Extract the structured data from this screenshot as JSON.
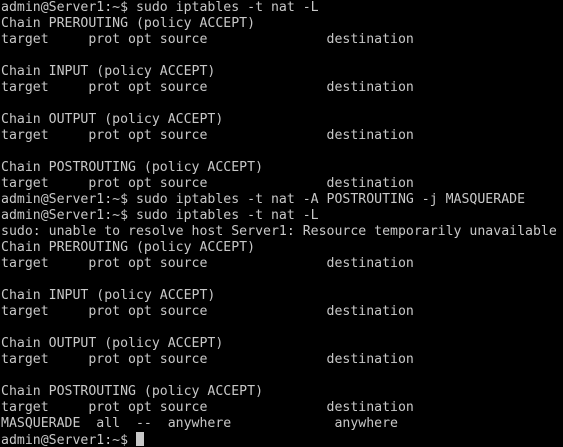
{
  "terminal": {
    "lines": [
      "admin@Server1:~$ sudo iptables -t nat -L",
      "Chain PREROUTING (policy ACCEPT)",
      "target     prot opt source               destination",
      "",
      "Chain INPUT (policy ACCEPT)",
      "target     prot opt source               destination",
      "",
      "Chain OUTPUT (policy ACCEPT)",
      "target     prot opt source               destination",
      "",
      "Chain POSTROUTING (policy ACCEPT)",
      "target     prot opt source               destination",
      "admin@Server1:~$ sudo iptables -t nat -A POSTROUTING -j MASQUERADE",
      "admin@Server1:~$ sudo iptables -t nat -L",
      "sudo: unable to resolve host Server1: Resource temporarily unavailable",
      "Chain PREROUTING (policy ACCEPT)",
      "target     prot opt source               destination",
      "",
      "Chain INPUT (policy ACCEPT)",
      "target     prot opt source               destination",
      "",
      "Chain OUTPUT (policy ACCEPT)",
      "target     prot opt source               destination",
      "",
      "Chain POSTROUTING (policy ACCEPT)",
      "target     prot opt source               destination",
      "MASQUERADE  all  --  anywhere             anywhere"
    ],
    "prompt": "admin@Server1:~$ ",
    "colors": {
      "background": "#000000",
      "foreground": "#c8c8c8"
    }
  }
}
